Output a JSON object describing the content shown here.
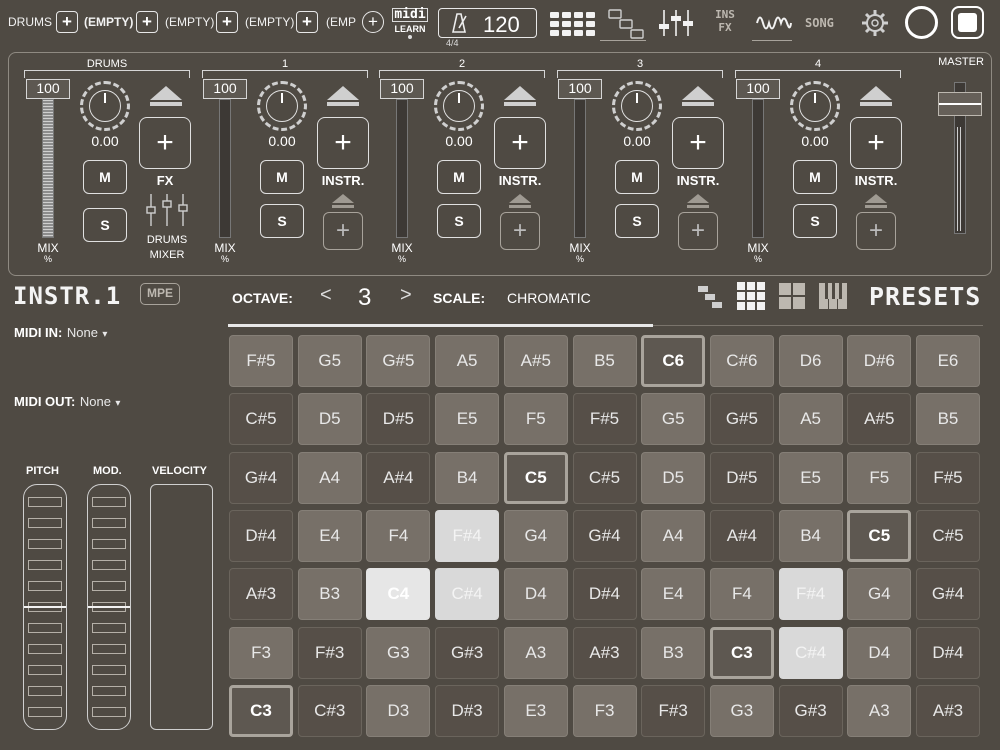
{
  "toolbar": {
    "tracks": [
      {
        "label": "DRUMS",
        "bold": false
      },
      {
        "label": "(EMPTY)",
        "bold": true
      },
      {
        "label": "(EMPTY)",
        "bold": false
      },
      {
        "label": "(EMPTY)",
        "bold": false
      },
      {
        "label": "(EMP",
        "bold": false
      }
    ],
    "plus": "+",
    "midi_learn": {
      "top": "midi",
      "bottom": "LEARN"
    },
    "bpm": "120",
    "time_sig": "4/4",
    "ins_fx": {
      "top": "INS",
      "bottom": "FX"
    },
    "song_label": "SONG",
    "icons": [
      "metronome-icon",
      "pattern-grid-icon",
      "arrange-icon",
      "mixer-icon",
      "waveform-icon",
      "gear-icon",
      "record-icon",
      "stop-icon"
    ]
  },
  "mixer": {
    "channels": [
      {
        "title": "DRUMS",
        "volume": "100",
        "pan": "0.00",
        "mute": "M",
        "solo": "S",
        "slot_label": "FX",
        "sub_label_1": "DRUMS",
        "sub_label_2": "MIXER",
        "mix": "MIX",
        "mix_unit": "%"
      },
      {
        "title": "1",
        "volume": "100",
        "pan": "0.00",
        "mute": "M",
        "solo": "S",
        "slot_label": "INSTR.",
        "mix": "MIX",
        "mix_unit": "%"
      },
      {
        "title": "2",
        "volume": "100",
        "pan": "0.00",
        "mute": "M",
        "solo": "S",
        "slot_label": "INSTR.",
        "mix": "MIX",
        "mix_unit": "%"
      },
      {
        "title": "3",
        "volume": "100",
        "pan": "0.00",
        "mute": "M",
        "solo": "S",
        "slot_label": "INSTR.",
        "mix": "MIX",
        "mix_unit": "%"
      },
      {
        "title": "4",
        "volume": "100",
        "pan": "0.00",
        "mute": "M",
        "solo": "S",
        "slot_label": "INSTR.",
        "mix": "MIX",
        "mix_unit": "%"
      }
    ],
    "master": "MASTER",
    "plus": "+"
  },
  "instrument": {
    "title": "INSTR.1",
    "mpe": "MPE",
    "octave_label": "OCTAVE:",
    "octave_prev": "<",
    "octave_value": "3",
    "octave_next": ">",
    "scale_label": "SCALE:",
    "scale_value": "CHROMATIC",
    "presets": "PRESETS"
  },
  "side": {
    "midi_in_label": "MIDI IN:",
    "midi_in_value": "None",
    "midi_out_label": "MIDI OUT:",
    "midi_out_value": "None",
    "dropdown_arrow": "▾",
    "pitch": "PITCH",
    "mod": "MOD.",
    "velocity": "VELOCITY"
  },
  "pads": [
    [
      [
        "F#5",
        "m"
      ],
      [
        "G5",
        "m"
      ],
      [
        "G#5",
        "m"
      ],
      [
        "A5",
        "m"
      ],
      [
        "A#5",
        "m"
      ],
      [
        "B5",
        "m"
      ],
      [
        "C6",
        "c"
      ],
      [
        "C#6",
        "m"
      ],
      [
        "D6",
        "m"
      ],
      [
        "D#6",
        "m"
      ],
      [
        "E6",
        "m"
      ]
    ],
    [
      [
        "C#5",
        "d"
      ],
      [
        "D5",
        "m"
      ],
      [
        "D#5",
        "d"
      ],
      [
        "E5",
        "m"
      ],
      [
        "F5",
        "m"
      ],
      [
        "F#5",
        "d"
      ],
      [
        "G5",
        "m"
      ],
      [
        "G#5",
        "d"
      ],
      [
        "A5",
        "m"
      ],
      [
        "A#5",
        "d"
      ],
      [
        "B5",
        "m"
      ]
    ],
    [
      [
        "G#4",
        "d"
      ],
      [
        "A4",
        "m"
      ],
      [
        "A#4",
        "d"
      ],
      [
        "B4",
        "m"
      ],
      [
        "C5",
        "c"
      ],
      [
        "C#5",
        "d"
      ],
      [
        "D5",
        "m"
      ],
      [
        "D#5",
        "d"
      ],
      [
        "E5",
        "m"
      ],
      [
        "F5",
        "m"
      ],
      [
        "F#5",
        "d"
      ]
    ],
    [
      [
        "D#4",
        "d"
      ],
      [
        "E4",
        "m"
      ],
      [
        "F4",
        "m"
      ],
      [
        "F#4",
        "w"
      ],
      [
        "G4",
        "m"
      ],
      [
        "G#4",
        "d"
      ],
      [
        "A4",
        "m"
      ],
      [
        "A#4",
        "d"
      ],
      [
        "B4",
        "m"
      ],
      [
        "C5",
        "c"
      ],
      [
        "C#5",
        "d"
      ]
    ],
    [
      [
        "A#3",
        "d"
      ],
      [
        "B3",
        "m"
      ],
      [
        "C4",
        "wc"
      ],
      [
        "C#4",
        "w"
      ],
      [
        "D4",
        "m"
      ],
      [
        "D#4",
        "d"
      ],
      [
        "E4",
        "m"
      ],
      [
        "F4",
        "m"
      ],
      [
        "F#4",
        "w"
      ],
      [
        "G4",
        "m"
      ],
      [
        "G#4",
        "d"
      ]
    ],
    [
      [
        "F3",
        "m"
      ],
      [
        "F#3",
        "d"
      ],
      [
        "G3",
        "m"
      ],
      [
        "G#3",
        "d"
      ],
      [
        "A3",
        "m"
      ],
      [
        "A#3",
        "d"
      ],
      [
        "B3",
        "m"
      ],
      [
        "C3",
        "c"
      ],
      [
        "C#4",
        "w"
      ],
      [
        "D4",
        "m"
      ],
      [
        "D#4",
        "d"
      ]
    ],
    [
      [
        "C3",
        "c"
      ],
      [
        "C#3",
        "d"
      ],
      [
        "D3",
        "m"
      ],
      [
        "D#3",
        "d"
      ],
      [
        "E3",
        "m"
      ],
      [
        "F3",
        "m"
      ],
      [
        "F#3",
        "d"
      ],
      [
        "G3",
        "m"
      ],
      [
        "G#3",
        "d"
      ],
      [
        "A3",
        "m"
      ],
      [
        "A#3",
        "d"
      ]
    ]
  ]
}
